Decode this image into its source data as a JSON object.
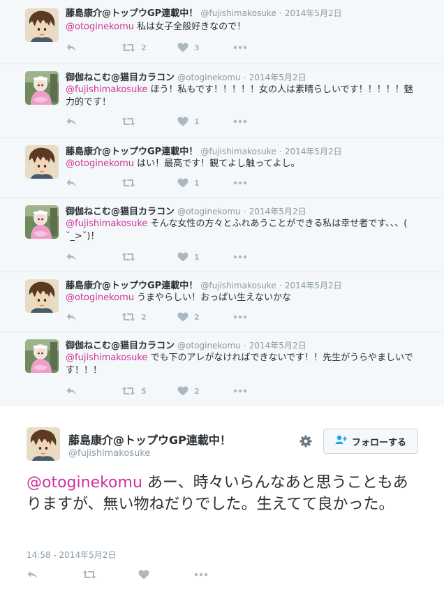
{
  "thread": [
    {
      "name": "藤島康介@トップウGP連載中！",
      "handle": "@fujishimakosuke",
      "dot": "·",
      "date": "2014年5月2日",
      "mention": "@otoginekomu",
      "text": " 私は女子全般好きなので！",
      "avatar": "fujishima",
      "retweets": "2",
      "likes": "3"
    },
    {
      "name": "御伽ねこむ@猫目カラコン",
      "handle": "@otoginekomu",
      "dot": "·",
      "date": "2014年5月2日",
      "mention": "@fujishimakosuke",
      "text": " ほう！私もです！！！！！女の人は素晴らしいです！！！！！魅力的です！",
      "avatar": "otogi",
      "retweets": "",
      "likes": "1"
    },
    {
      "name": "藤島康介@トップウGP連載中！",
      "handle": "@fujishimakosuke",
      "dot": "·",
      "date": "2014年5月2日",
      "mention": "@otoginekomu",
      "text": " はい！最高です！観てよし触ってよし。",
      "avatar": "fujishima",
      "retweets": "",
      "likes": "1"
    },
    {
      "name": "御伽ねこむ@猫目カラコン",
      "handle": "@otoginekomu",
      "dot": "·",
      "date": "2014年5月2日",
      "mention": "@fujishimakosuke",
      "text": " そんな女性の方々とふれあうことができる私は幸せ者です、、、( ˘_>˘)！",
      "avatar": "otogi",
      "retweets": "",
      "likes": "1"
    },
    {
      "name": "藤島康介@トップウGP連載中！",
      "handle": "@fujishimakosuke",
      "dot": "·",
      "date": "2014年5月2日",
      "mention": "@otoginekomu",
      "text": " うまやらしい！おっぱい生えないかな",
      "avatar": "fujishima",
      "retweets": "2",
      "likes": "2"
    },
    {
      "name": "御伽ねこむ@猫目カラコン",
      "handle": "@otoginekomu",
      "dot": "·",
      "date": "2014年5月2日",
      "mention": "@fujishimakosuke",
      "text": " でも下のアレがなければできないです！！先生がうらやましいです！！！",
      "avatar": "otogi",
      "retweets": "5",
      "likes": "2"
    }
  ],
  "main": {
    "name": "藤島康介@トップウGP連載中！",
    "handle": "@fujishimakosuke",
    "follow_label": "フォローする",
    "mention": "@otoginekomu",
    "text": " あー、時々いらんなあと思うこともありますが、無い物ねだりでした。生えてて良かった。",
    "timestamp": "14:58 - 2014年5月2日"
  },
  "icons": {
    "reply": "reply-icon",
    "retweet": "retweet-icon",
    "like": "heart-icon",
    "more": "more-icon",
    "gear": "gear-icon",
    "follow": "add-user-icon"
  },
  "colors": {
    "mention": "#cc3399",
    "meta": "#8899a6",
    "action": "#aab8c2",
    "background": "#f5f8fa"
  }
}
